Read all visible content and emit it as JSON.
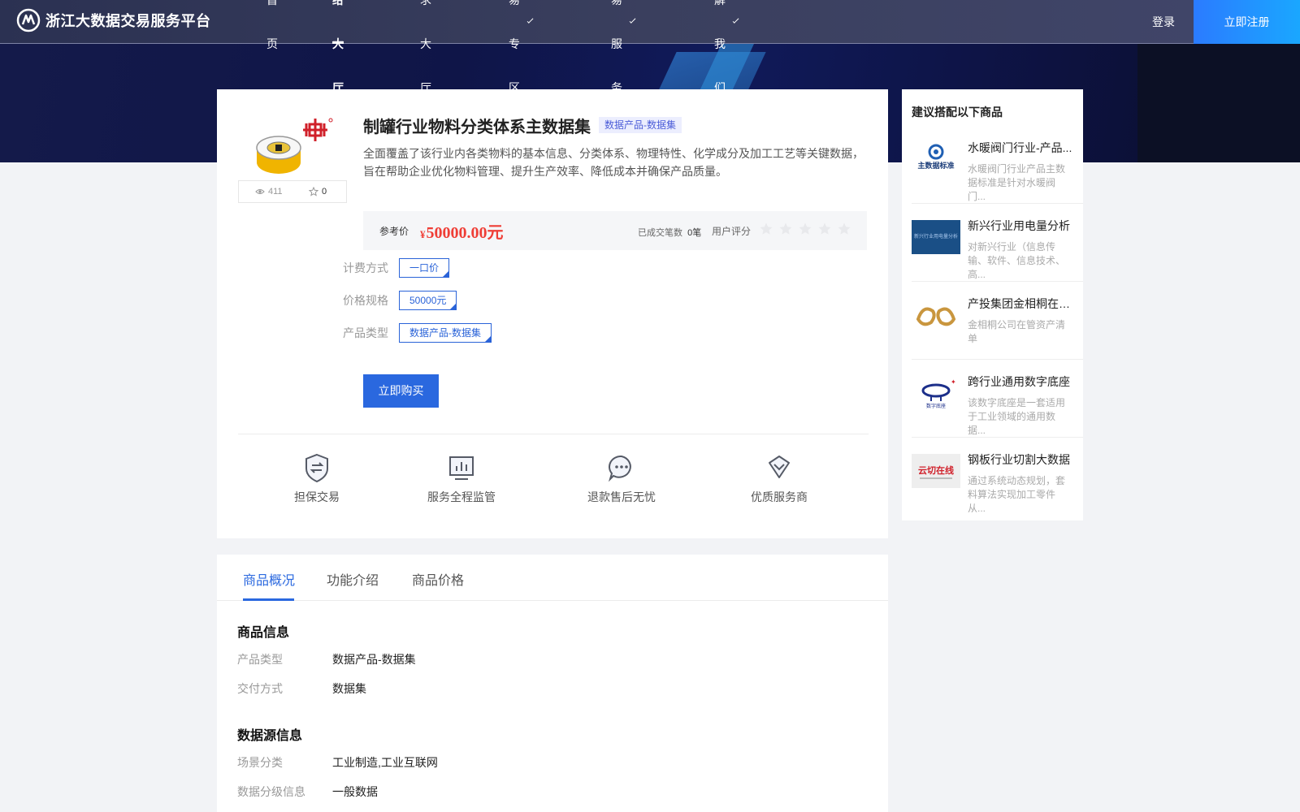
{
  "header": {
    "logo_text": "浙江大数据交易服务平台",
    "nav": [
      {
        "label": "首页"
      },
      {
        "label": "供给大厅"
      },
      {
        "label": "需求大厅"
      },
      {
        "label": "交易专区"
      },
      {
        "label": "交易服务"
      },
      {
        "label": "了解我们"
      }
    ],
    "active_nav": "供给大厅",
    "login_label": "登录",
    "register_label": "立即注册"
  },
  "product": {
    "title": "制罐行业物料分类体系主数据集",
    "tag": "数据产品-数据集",
    "description": "全面覆盖了该行业内各类物料的基本信息、分类体系、物理特性、化学成分及加工工艺等关键数据，旨在帮助企业优化物料管理、提升生产效率、降低成本并确保产品质量。",
    "views": "411",
    "favorites": "0",
    "price_label": "参考价",
    "price_symbol": "¥",
    "price": "50000.00元",
    "deals_label": "已成交笔数",
    "deals_count": "0笔",
    "rating_label": "用户评分",
    "rating": 0,
    "rating_max": 5,
    "specs": [
      {
        "label": "计费方式",
        "value": "一口价"
      },
      {
        "label": "价格规格",
        "value": "50000元"
      },
      {
        "label": "产品类型",
        "value": "数据产品-数据集"
      }
    ],
    "buy_label": "立即购买",
    "features": [
      {
        "label": "担保交易",
        "icon": "shield-exchange-icon"
      },
      {
        "label": "服务全程监管",
        "icon": "monitor-chart-icon"
      },
      {
        "label": "退款售后无忧",
        "icon": "chat-bubble-icon"
      },
      {
        "label": "优质服务商",
        "icon": "diamond-badge-icon"
      }
    ]
  },
  "tabs": [
    {
      "label": "商品概况"
    },
    {
      "label": "功能介绍"
    },
    {
      "label": "商品价格"
    }
  ],
  "active_tab": "商品概况",
  "details": {
    "info_title": "商品信息",
    "info_rows": [
      {
        "key": "产品类型",
        "value": "数据产品-数据集"
      },
      {
        "key": "交付方式",
        "value": "数据集"
      }
    ],
    "source_title": "数据源信息",
    "source_rows": [
      {
        "key": "场景分类",
        "value": "工业制造,工业互联网"
      },
      {
        "key": "数据分级信息",
        "value": "一般数据"
      }
    ]
  },
  "sidebar": {
    "title": "建议搭配以下商品",
    "items": [
      {
        "name": "水暖阀门行业-产品...",
        "desc": "水暖阀门行业产品主数据标准是针对水暖阀门...",
        "logo_text": "主数据标准"
      },
      {
        "name": "新兴行业用电量分析",
        "desc": "对新兴行业（信息传输、软件、信息技术、高...",
        "logo_text": "新兴行业用电量分析"
      },
      {
        "name": "产投集团金相桐在管...",
        "desc": "金相桐公司在管资产清单",
        "logo_text": ""
      },
      {
        "name": "跨行业通用数字底座",
        "desc": "该数字底座是一套适用于工业领域的通用数据...",
        "logo_text": "数字底座"
      },
      {
        "name": "钢板行业切割大数据",
        "desc": "通过系统动态规划，套料算法实现加工零件从...",
        "logo_text": "云切在线"
      }
    ]
  },
  "colors": {
    "accent": "#2a68df",
    "price": "#ef3e36",
    "header_bg": "#3a3f5e",
    "banner_bg": "#0f1548"
  }
}
